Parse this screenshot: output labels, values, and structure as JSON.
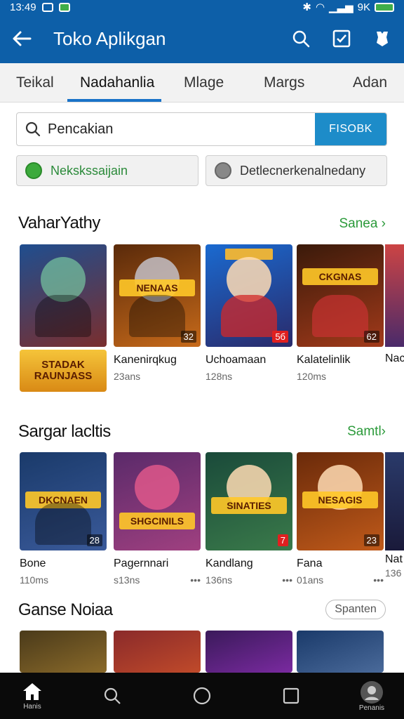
{
  "status_bar": {
    "time": "13:49",
    "battery_text": "9K"
  },
  "app_bar": {
    "title": "Toko Aplikgan"
  },
  "tabs": [
    {
      "label": "Teikal"
    },
    {
      "label": "Nadahanlia",
      "active": true
    },
    {
      "label": "Mlage"
    },
    {
      "label": "Margs"
    },
    {
      "label": "Adan"
    }
  ],
  "search": {
    "placeholder": "Pencakian",
    "button_label": "FISOBK"
  },
  "chips": [
    {
      "label": "Nekskssaijain"
    },
    {
      "label": "Detlecnerkenalnedany"
    }
  ],
  "sections": [
    {
      "title": "VaharYathy",
      "see_more": "Sanea ›",
      "cards": [
        {
          "name": "",
          "meta": "",
          "banner": "STADAK RAUNJASS",
          "colors": [
            "#1f4e8f",
            "#7a2e2e"
          ]
        },
        {
          "name": "Kanenirqkug",
          "meta": "23ans",
          "logo": "NENAAS",
          "badge": "32",
          "colors": [
            "#5a2a0a",
            "#c76a1a"
          ]
        },
        {
          "name": "Uchoamaan",
          "meta": "128ns",
          "logo": "",
          "badge": "5б",
          "colors": [
            "#1a6ad0",
            "#2a2a6a"
          ]
        },
        {
          "name": "Kalatelinlik",
          "meta": "120ms",
          "logo": "CKGNAS",
          "badge": "62",
          "colors": [
            "#3a1a0a",
            "#a23a1a"
          ]
        },
        {
          "name": "Nac",
          "meta": "",
          "colors": [
            "#6a2a2a",
            "#2a1a4a"
          ]
        }
      ]
    },
    {
      "title": "Sargar lacltis",
      "see_more": "Samtl›",
      "cards": [
        {
          "name": "Bone",
          "meta": "110ms",
          "logo": "DKCNAEN",
          "badge": "28",
          "colors": [
            "#1a3a6a",
            "#3a5a9a"
          ]
        },
        {
          "name": "Pagernnari",
          "meta": "s13ns",
          "logo": "SHGCINILS",
          "badge": "",
          "colors": [
            "#5a2a6a",
            "#a04080"
          ]
        },
        {
          "name": "Kandlang",
          "meta": "136ns",
          "logo": "SINATIES",
          "badge": "",
          "colors": [
            "#1a4a3a",
            "#3a7a4a"
          ]
        },
        {
          "name": "Fana",
          "meta": "01ans",
          "logo": "NESAGIS",
          "badge": "23",
          "colors": [
            "#6a2a0a",
            "#c05a1a"
          ]
        },
        {
          "name": "Nat",
          "meta": "136",
          "colors": [
            "#2a3a6a",
            "#1a1a3a"
          ]
        }
      ]
    },
    {
      "title": "Ganse Noiaa",
      "see_more": "Spanten",
      "cards": [
        {
          "name": "",
          "meta": "",
          "colors": [
            "#4a3a1a",
            "#8a6a2a"
          ]
        },
        {
          "name": "",
          "meta": "",
          "colors": [
            "#8a2a2a",
            "#c04a2a"
          ]
        },
        {
          "name": "",
          "meta": "",
          "colors": [
            "#3a1a5a",
            "#7a2aa0"
          ]
        },
        {
          "name": "",
          "meta": "",
          "colors": [
            "#1a3a6a",
            "#4a6a9a"
          ]
        }
      ]
    }
  ],
  "bottom_nav": [
    {
      "label": "Hanis",
      "icon": "home-icon"
    },
    {
      "label": "",
      "icon": "search-icon"
    },
    {
      "label": "",
      "icon": "circle-icon"
    },
    {
      "label": "",
      "icon": "square-icon"
    },
    {
      "label": "Penanis",
      "icon": "profile-icon"
    }
  ]
}
